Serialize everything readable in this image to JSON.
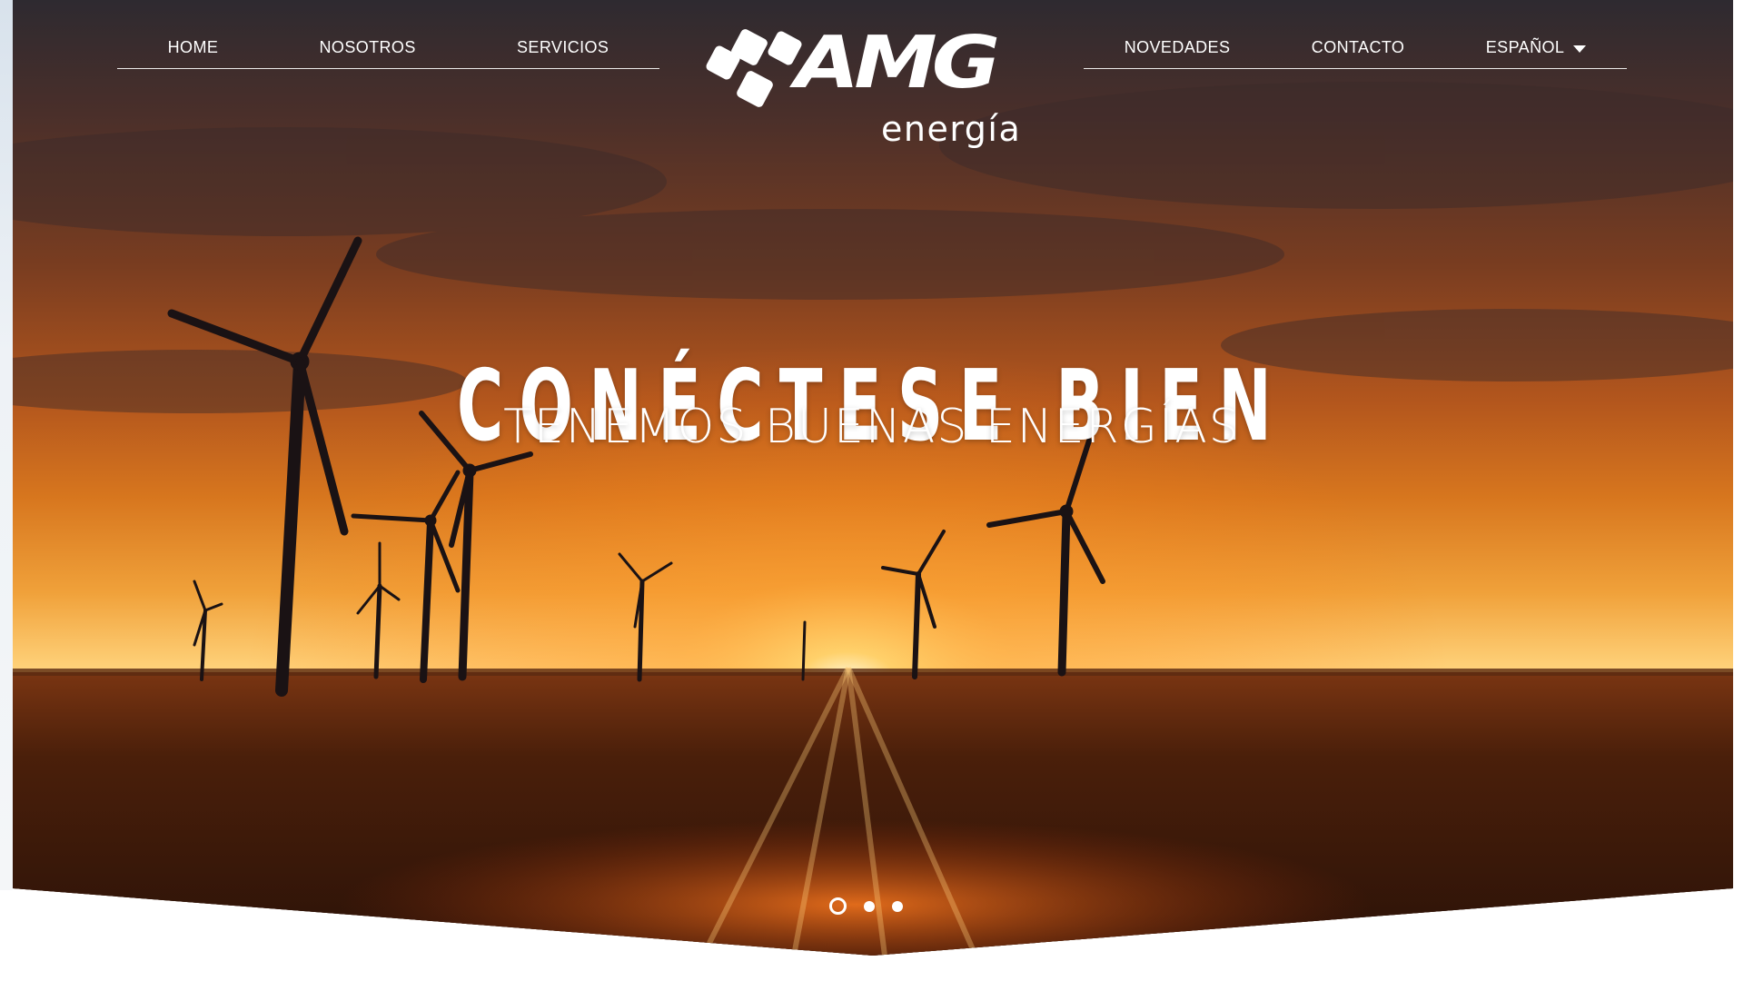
{
  "nav": {
    "left": [
      {
        "label": "HOME"
      },
      {
        "label": "NOSOTROS"
      },
      {
        "label": "SERVICIOS"
      }
    ],
    "right": [
      {
        "label": "NOVEDADES"
      },
      {
        "label": "CONTACTO"
      }
    ],
    "language": {
      "selected": "ESPAÑOL",
      "icon": "caret-down-icon"
    }
  },
  "logo": {
    "name": "AMG",
    "tagline": "energía"
  },
  "hero": {
    "headline": "CONÉCTESE BIEN",
    "subheadline": "TENEMOS BUENAS ENERGÍAS",
    "image_subject": "wind-turbines-at-sunset"
  },
  "slider": {
    "count": 3,
    "active_index": 0
  },
  "colors": {
    "text": "#ffffff",
    "sky_top": "#3b2a2c",
    "sun_glow": "#ffb13a",
    "field": "#3a1a0a"
  }
}
